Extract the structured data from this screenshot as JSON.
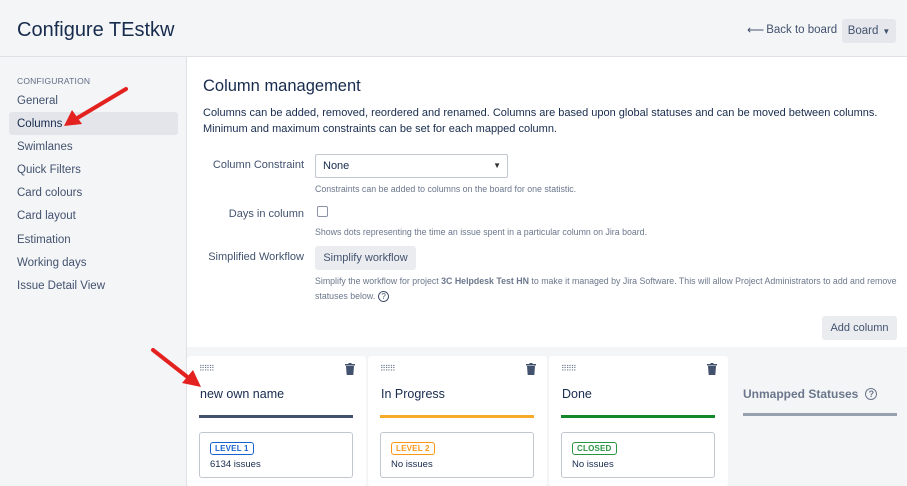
{
  "header": {
    "title": "Configure TEstkw",
    "back_label": "Back to board",
    "back_icon": "left-arrow-icon",
    "board_label": "Board"
  },
  "sidebar": {
    "heading": "CONFIGURATION",
    "items": [
      {
        "label": "General"
      },
      {
        "label": "Columns"
      },
      {
        "label": "Swimlanes"
      },
      {
        "label": "Quick Filters"
      },
      {
        "label": "Card colours"
      },
      {
        "label": "Card layout"
      },
      {
        "label": "Estimation"
      },
      {
        "label": "Working days"
      },
      {
        "label": "Issue Detail View"
      }
    ],
    "active": "Columns"
  },
  "main": {
    "title": "Column management",
    "description": "Columns can be added, removed, reordered and renamed. Columns are based upon global statuses and can be moved between columns. Minimum and maximum constraints can be set for each mapped column.",
    "constraint_label": "Column Constraint",
    "constraint_value": "None",
    "constraint_help": "Constraints can be added to columns on the board for one statistic.",
    "days_label": "Days in column",
    "days_checked": false,
    "days_help": "Shows dots representing the time an issue spent in a particular column on Jira board.",
    "workflow_label": "Simplified Workflow",
    "workflow_button": "Simplify workflow",
    "workflow_help_pre": "Simplify the workflow for project ",
    "workflow_help_project": "3C Helpdesk Test HN",
    "workflow_help_post": " to make it managed by Jira Software. This will allow Project Administrators to add and remove statuses below.",
    "add_column": "Add column"
  },
  "columns": [
    {
      "name": "new own name",
      "bar_color": "#42526e",
      "status": "LEVEL 1",
      "status_color": "#0052cc",
      "count": "6134 issues"
    },
    {
      "name": "In Progress",
      "bar_color": "#f6a92a",
      "status": "LEVEL 2",
      "status_color": "#ff8b00",
      "count": "No issues"
    },
    {
      "name": "Done",
      "bar_color": "#14892c",
      "status": "CLOSED",
      "status_color": "#14892c",
      "count": "No issues"
    }
  ],
  "unmapped": {
    "label": "Unmapped Statuses"
  },
  "colors": {
    "annotation_arrow": "#e3221f"
  }
}
